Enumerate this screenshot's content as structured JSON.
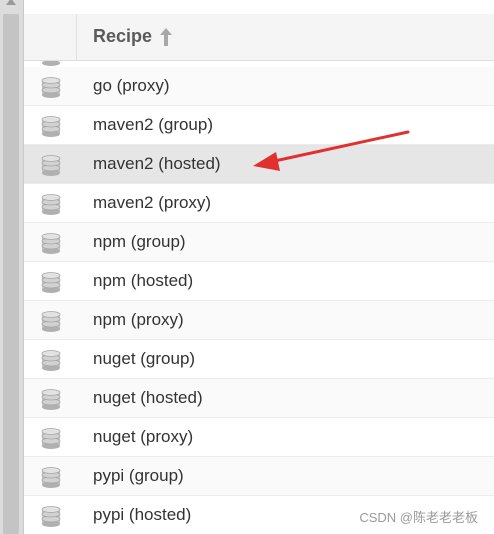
{
  "table": {
    "column_header": "Recipe",
    "sort_direction": "ascending",
    "rows": [
      {
        "label": "go (proxy)",
        "icon": "database-icon",
        "highlighted": false
      },
      {
        "label": "maven2 (group)",
        "icon": "database-icon",
        "highlighted": false
      },
      {
        "label": "maven2 (hosted)",
        "icon": "database-icon",
        "highlighted": true
      },
      {
        "label": "maven2 (proxy)",
        "icon": "database-icon",
        "highlighted": false
      },
      {
        "label": "npm (group)",
        "icon": "database-icon",
        "highlighted": false
      },
      {
        "label": "npm (hosted)",
        "icon": "database-icon",
        "highlighted": false
      },
      {
        "label": "npm (proxy)",
        "icon": "database-icon",
        "highlighted": false
      },
      {
        "label": "nuget (group)",
        "icon": "database-icon",
        "highlighted": false
      },
      {
        "label": "nuget (hosted)",
        "icon": "database-icon",
        "highlighted": false
      },
      {
        "label": "nuget (proxy)",
        "icon": "database-icon",
        "highlighted": false
      },
      {
        "label": "pypi (group)",
        "icon": "database-icon",
        "highlighted": false
      },
      {
        "label": "pypi (hosted)",
        "icon": "database-icon",
        "highlighted": false
      }
    ]
  },
  "annotation": {
    "color": "#e03030",
    "points_to": "maven2 (hosted)"
  },
  "watermark": "CSDN @陈老老老板",
  "colors": {
    "highlight_row": "#e6e6e6",
    "header_bg": "#f5f5f5",
    "icon": "#b8b8b8"
  }
}
